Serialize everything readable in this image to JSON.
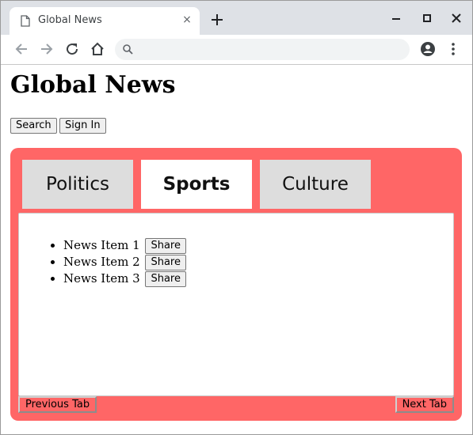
{
  "browser": {
    "tab_title": "Global News",
    "tab_close": "×",
    "new_tab": "+",
    "icons": [
      "document-icon",
      "close-icon",
      "plus-icon",
      "minimize-icon",
      "maximize-icon",
      "close-window-icon",
      "back-icon",
      "forward-icon",
      "reload-icon",
      "home-icon",
      "search-icon",
      "profile-icon",
      "menu-icon"
    ]
  },
  "page": {
    "title": "Global News",
    "search_button": "Search",
    "signin_button": "Sign In",
    "tabs": [
      {
        "label": "Politics",
        "active": false
      },
      {
        "label": "Sports",
        "active": true
      },
      {
        "label": "Culture",
        "active": false
      }
    ],
    "news_items": [
      {
        "label": "News Item 1",
        "share": "Share"
      },
      {
        "label": "News Item 2",
        "share": "Share"
      },
      {
        "label": "News Item 3",
        "share": "Share"
      }
    ],
    "previous_tab": "Previous Tab",
    "next_tab": "Next Tab"
  },
  "colors": {
    "panel": "#ff6666",
    "inactive_tab": "#dddddd",
    "active_tab": "#ffffff",
    "chrome_titlebar": "#dee1e6"
  }
}
